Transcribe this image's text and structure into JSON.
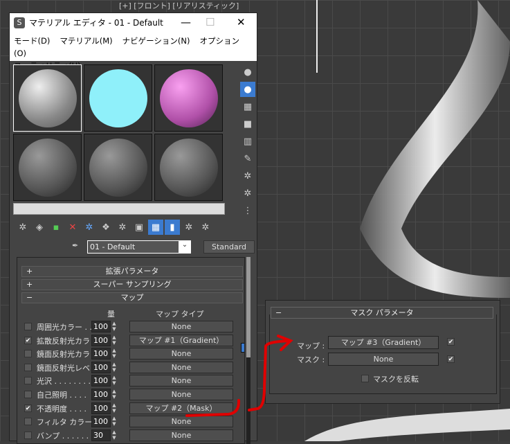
{
  "viewport": {
    "label": "[+] [フロント] [リアリスティック]"
  },
  "window": {
    "title": "マテリアル エディタ - 01 - Default",
    "minimize": "—",
    "maximize": "☐",
    "close": "✕"
  },
  "menu": [
    "モード(D)",
    "マテリアル(M)",
    "ナビゲーション(N)",
    "オプション(O)",
    "ユーティリティ(U)"
  ],
  "material": {
    "name": "01 - Default",
    "type": "Standard"
  },
  "rollouts": {
    "extended": "拡張パラメータ",
    "supersampling": "スーパー サンプリング",
    "maps": "マップ",
    "expand": "+",
    "collapse": "−"
  },
  "maps": {
    "amount_header": "量",
    "maptype_header": "マップ タイプ",
    "rows": [
      {
        "label": "周囲光カラー . .",
        "checked": false,
        "amount": "100",
        "map": "None"
      },
      {
        "label": "拡散反射光カラ",
        "checked": true,
        "amount": "100",
        "map": "マップ #1（Gradient）"
      },
      {
        "label": "鏡面反射光カラ",
        "checked": false,
        "amount": "100",
        "map": "None"
      },
      {
        "label": "鏡面反射光レベ",
        "checked": false,
        "amount": "100",
        "map": "None"
      },
      {
        "label": "光沢 . . . . . . . .",
        "checked": false,
        "amount": "100",
        "map": "None"
      },
      {
        "label": "自己照明 . . . .",
        "checked": false,
        "amount": "100",
        "map": "None"
      },
      {
        "label": "不透明度 . . . .",
        "checked": true,
        "amount": "100",
        "map": "マップ #2（Mask）"
      },
      {
        "label": "フィルタ カラー . .",
        "checked": false,
        "amount": "100",
        "map": "None"
      },
      {
        "label": "バンプ . . . . . . .",
        "checked": false,
        "amount": "30",
        "map": "None"
      }
    ]
  },
  "mask_params": {
    "title": "マスク パラメータ",
    "collapse": "−",
    "map_label": "マップ :",
    "map_value": "マップ #3（Gradient）",
    "mask_label": "マスク :",
    "mask_value": "None",
    "invert_label": "マスクを反転",
    "map_enabled": true,
    "mask_enabled": true,
    "invert": false
  },
  "colors": {
    "annotation": "#e00000",
    "accent": "#3b7bd0"
  }
}
